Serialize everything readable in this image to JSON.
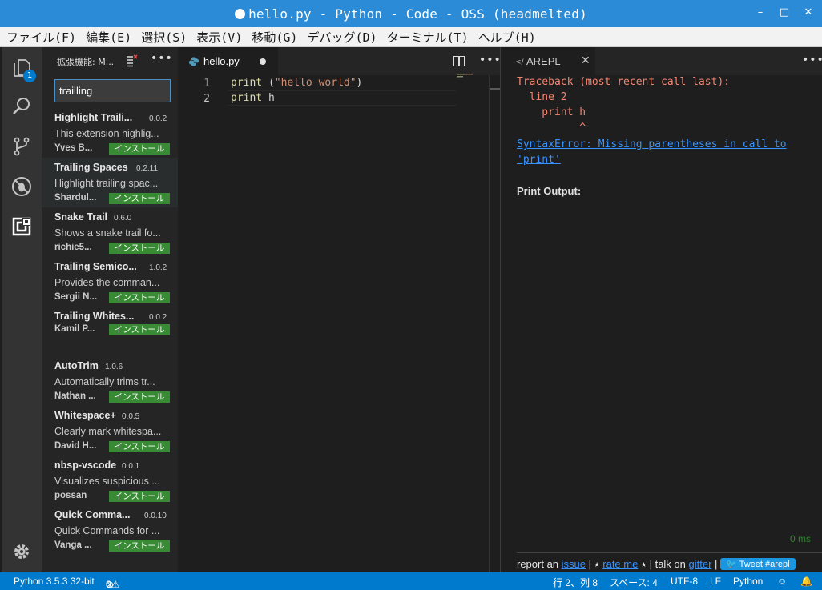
{
  "window": {
    "title": "hello.py - Python - Code - OSS (headmelted)",
    "buttons": [
      "–",
      "□",
      "✕"
    ]
  },
  "menu": [
    "ファイル(F)",
    "編集(E)",
    "選択(S)",
    "表示(V)",
    "移動(G)",
    "デバッグ(D)",
    "ターミナル(T)",
    "ヘルプ(H)"
  ],
  "activity": {
    "explorer_badge": "1"
  },
  "sidebar": {
    "title": "拡張機能: M...",
    "search_value": "trailling",
    "install_label": "インストール",
    "extensions": [
      {
        "name": "Highlight Traili...",
        "version": "0.0.2",
        "description": "This extension highlig...",
        "author": "Yves B..."
      },
      {
        "name": "Trailing Spaces",
        "version": "0.2.11",
        "description": "Highlight trailing spac...",
        "author": "Shardul..."
      },
      {
        "name": "Snake Trail",
        "version": "0.6.0",
        "description": "Shows a snake trail fo...",
        "author": "richie5..."
      },
      {
        "name": "Trailing Semico...",
        "version": "1.0.2",
        "description": "Provides the comman...",
        "author": "Sergii N..."
      },
      {
        "name": "Trailing Whites...",
        "version": "0.0.2",
        "description": "",
        "author": "Kamil P..."
      },
      {
        "name": "AutoTrim",
        "version": "1.0.6",
        "description": "Automatically trims tr...",
        "author": "Nathan ..."
      },
      {
        "name": "Whitespace+",
        "version": "0.0.5",
        "description": "Clearly mark whitespa...",
        "author": "David H..."
      },
      {
        "name": "nbsp-vscode",
        "version": "0.0.1",
        "description": "Visualizes suspicious ...",
        "author": "possan"
      },
      {
        "name": "Quick Comma...",
        "version": "0.0.10",
        "description": "Quick Commands for ...",
        "author": "Vanga ..."
      }
    ]
  },
  "editor": {
    "tab_name": "hello.py",
    "lines": [
      {
        "number": "1",
        "keyword": "print",
        "rest_open": " (",
        "string": "\"hello world\"",
        "rest_close": ")"
      },
      {
        "number": "2",
        "keyword": "print",
        "rest": " h"
      }
    ]
  },
  "arepl": {
    "tab_name": "AREPL",
    "traceback": [
      "Traceback (most recent call last):",
      "  line 2",
      "    print h",
      "          ^"
    ],
    "error_link": "SyntaxError: Missing parentheses in call to 'print'",
    "print_output_label": "Print Output:",
    "timing": "0 ms",
    "footer": {
      "report_text": "report an",
      "issue_link": "issue",
      "sep1": " | ⭑ ",
      "rate_link": "rate me",
      "sep2": " ⭑ | talk on ",
      "gitter_link": "gitter",
      "sep3": " | ",
      "tweet_label": "Tweet #arepl"
    }
  },
  "statusbar": {
    "python_version": "Python 3.5.3 32-bit",
    "errors": "0",
    "warnings": "0",
    "position": "行 2、列 8",
    "spaces": "スペース: 4",
    "encoding": "UTF-8",
    "eol": "LF",
    "language": "Python"
  },
  "colors": {
    "accent": "#007acc",
    "install": "#388a34",
    "error_text": "#f48771",
    "link": "#3794ff"
  }
}
